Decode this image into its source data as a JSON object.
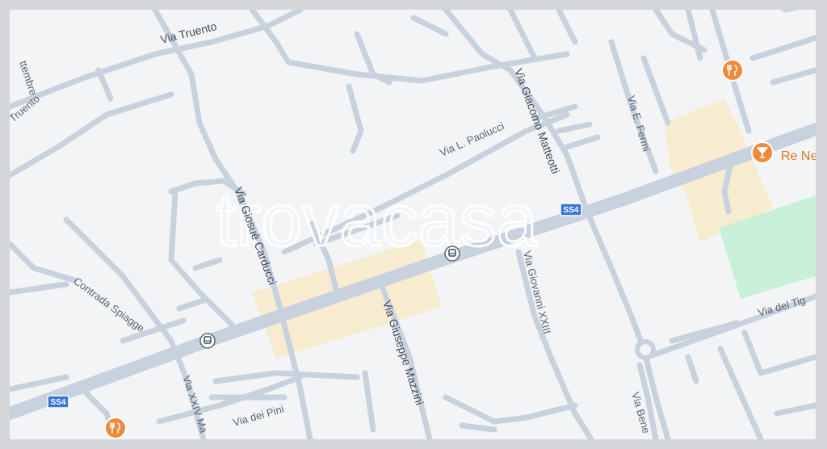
{
  "map": {
    "watermark": "trovacasa",
    "streets": {
      "via_truento_top": "Via Truento",
      "truento_left": "Truento",
      "settembre_left": "ttembre",
      "via_paolucci": "Via L. Paolucci",
      "via_matteotti": "Via Giacomo Matteotti",
      "via_fermi": "Via E. Fermi",
      "via_carducci": "Via Giosuè Carducci",
      "contrada_spiagge": "Contrada Spiagge",
      "via_mazzini": "Via Giuseppe Mazzini",
      "via_giovanni": "Via Giovanni XXIII",
      "via_del_tiglio": "Via del Tig",
      "via_xxiv": "Via XXIV Ma",
      "via_dei_pini": "Via dei Pini",
      "via_bene": "Via Bene"
    },
    "route_shields": [
      {
        "label": "SS4"
      },
      {
        "label": "SS4"
      }
    ],
    "pois": [
      {
        "icon": "restaurant-icon",
        "label": ""
      },
      {
        "icon": "cocktail-bar-icon",
        "label": "Re Ne"
      },
      {
        "icon": "restaurant-icon",
        "label": ""
      }
    ],
    "transit": [
      {
        "icon": "bus-stop-icon"
      },
      {
        "icon": "bus-stop-icon"
      }
    ],
    "colors": {
      "background": "#f3f4f6",
      "road": "#c7d2de",
      "main_road": "#b9c6d4",
      "commercial_area": "#f8ecd0",
      "park": "#c9f0d8",
      "poi": "#f2893a",
      "shield": "#3b78d6"
    }
  }
}
